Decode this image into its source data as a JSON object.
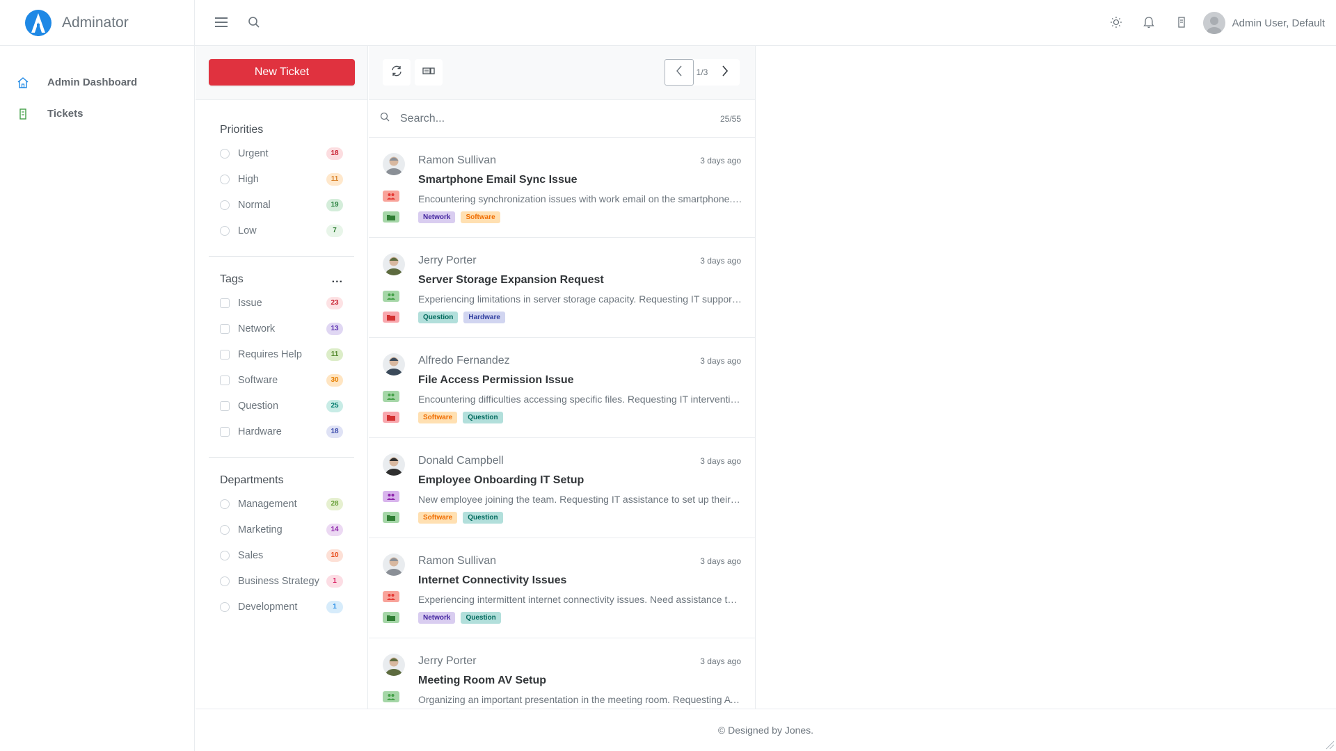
{
  "brand": {
    "name": "Adminator",
    "accent": "#1e88e5"
  },
  "header": {
    "user_name": "Admin User, Default",
    "icons": [
      "menu-icon",
      "search-icon",
      "sun-icon",
      "bell-icon",
      "bookmark-icon"
    ]
  },
  "sidenav": {
    "items": [
      {
        "label": "Admin Dashboard",
        "icon": "home-icon"
      },
      {
        "label": "Tickets",
        "icon": "ticket-icon"
      }
    ]
  },
  "filters": {
    "new_ticket_label": "New Ticket",
    "priorities": {
      "title": "Priorities",
      "items": [
        {
          "label": "Urgent",
          "count": "18",
          "bg": "#fcdde0",
          "fg": "#c82333"
        },
        {
          "label": "High",
          "count": "11",
          "bg": "#ffe8cc",
          "fg": "#d9822b"
        },
        {
          "label": "Normal",
          "count": "19",
          "bg": "#d4edda",
          "fg": "#28803e"
        },
        {
          "label": "Low",
          "count": "7",
          "bg": "#e8f5e9",
          "fg": "#2e7d32"
        }
      ]
    },
    "tags": {
      "title": "Tags",
      "more": "...",
      "items": [
        {
          "label": "Issue",
          "count": "23",
          "bg": "#fde2e4",
          "fg": "#c82333"
        },
        {
          "label": "Network",
          "count": "13",
          "bg": "#e0d7f3",
          "fg": "#5e35b1"
        },
        {
          "label": "Requires Help",
          "count": "11",
          "bg": "#dcedc8",
          "fg": "#558b2f"
        },
        {
          "label": "Software",
          "count": "30",
          "bg": "#ffe5c2",
          "fg": "#e67e00"
        },
        {
          "label": "Question",
          "count": "25",
          "bg": "#c8ece6",
          "fg": "#00796b"
        },
        {
          "label": "Hardware",
          "count": "18",
          "bg": "#dfe2f5",
          "fg": "#3949ab"
        }
      ]
    },
    "departments": {
      "title": "Departments",
      "items": [
        {
          "label": "Management",
          "count": "28",
          "bg": "#e6f0d0",
          "fg": "#689f38"
        },
        {
          "label": "Marketing",
          "count": "14",
          "bg": "#ecd9f3",
          "fg": "#8e24aa"
        },
        {
          "label": "Sales",
          "count": "10",
          "bg": "#fde0d6",
          "fg": "#e64a19"
        },
        {
          "label": "Business Strategy",
          "count": "1",
          "bg": "#fcdde4",
          "fg": "#d81b60"
        },
        {
          "label": "Development",
          "count": "1",
          "bg": "#d7ecfb",
          "fg": "#1e88e5"
        }
      ]
    }
  },
  "list": {
    "pager_text": "1/3",
    "search_placeholder": "Search...",
    "search_count": "25/55",
    "tickets": [
      {
        "name": "Ramon Sullivan",
        "time": "3 days ago",
        "title": "Smartphone Email Sync Issue",
        "desc": "Encountering synchronization issues with work email on the smartphone. Requesting IT assistance.",
        "prio_bg": "#f8a39a",
        "prio_fg": "#e53935",
        "dept_bg": "#a5d6a7",
        "dept_fg": "#2e7d32",
        "avatar": "#8a8f96",
        "tags": [
          {
            "label": "Network",
            "bg": "#d9cdf0",
            "fg": "#4527a0"
          },
          {
            "label": "Software",
            "bg": "#ffe0b2",
            "fg": "#ef6c00"
          }
        ]
      },
      {
        "name": "Jerry Porter",
        "time": "3 days ago",
        "title": "Server Storage Expansion Request",
        "desc": "Experiencing limitations in server storage capacity. Requesting IT support for expansion.",
        "prio_bg": "#a5d6a7",
        "prio_fg": "#43a047",
        "dept_bg": "#f8a7ad",
        "dept_fg": "#d32f2f",
        "avatar": "#5d6b3f",
        "tags": [
          {
            "label": "Question",
            "bg": "#b2dfdb",
            "fg": "#00695c"
          },
          {
            "label": "Hardware",
            "bg": "#d1d5f0",
            "fg": "#303f9f"
          }
        ]
      },
      {
        "name": "Alfredo Fernandez",
        "time": "3 days ago",
        "title": "File Access Permission Issue",
        "desc": "Encountering difficulties accessing specific files. Requesting IT intervention to resolve.",
        "prio_bg": "#a5d6a7",
        "prio_fg": "#43a047",
        "dept_bg": "#f8a7ad",
        "dept_fg": "#d32f2f",
        "avatar": "#3b4a5a",
        "tags": [
          {
            "label": "Software",
            "bg": "#ffe0b2",
            "fg": "#ef6c00"
          },
          {
            "label": "Question",
            "bg": "#b2dfdb",
            "fg": "#00695c"
          }
        ]
      },
      {
        "name": "Donald Campbell",
        "time": "3 days ago",
        "title": "Employee Onboarding IT Setup",
        "desc": "New employee joining the team. Requesting IT assistance to set up their accounts.",
        "prio_bg": "#d8b4ec",
        "prio_fg": "#8e24aa",
        "dept_bg": "#a5d6a7",
        "dept_fg": "#2e7d32",
        "avatar": "#2f2f2f",
        "tags": [
          {
            "label": "Software",
            "bg": "#ffe0b2",
            "fg": "#ef6c00"
          },
          {
            "label": "Question",
            "bg": "#b2dfdb",
            "fg": "#00695c"
          }
        ]
      },
      {
        "name": "Ramon Sullivan",
        "time": "3 days ago",
        "title": "Internet Connectivity Issues",
        "desc": "Experiencing intermittent internet connectivity issues. Need assistance to resolve quickly.",
        "prio_bg": "#f8a39a",
        "prio_fg": "#e53935",
        "dept_bg": "#a5d6a7",
        "dept_fg": "#2e7d32",
        "avatar": "#8a8f96",
        "tags": [
          {
            "label": "Network",
            "bg": "#d9cdf0",
            "fg": "#4527a0"
          },
          {
            "label": "Question",
            "bg": "#b2dfdb",
            "fg": "#00695c"
          }
        ]
      },
      {
        "name": "Jerry Porter",
        "time": "3 days ago",
        "title": "Meeting Room AV Setup",
        "desc": "Organizing an important presentation in the meeting room. Requesting AV setup support.",
        "prio_bg": "#a5d6a7",
        "prio_fg": "#43a047",
        "dept_bg": "#a5d6a7",
        "dept_fg": "#2e7d32",
        "avatar": "#5d6b3f",
        "tags": []
      }
    ]
  },
  "footer": {
    "text": "© Designed by Jones."
  }
}
